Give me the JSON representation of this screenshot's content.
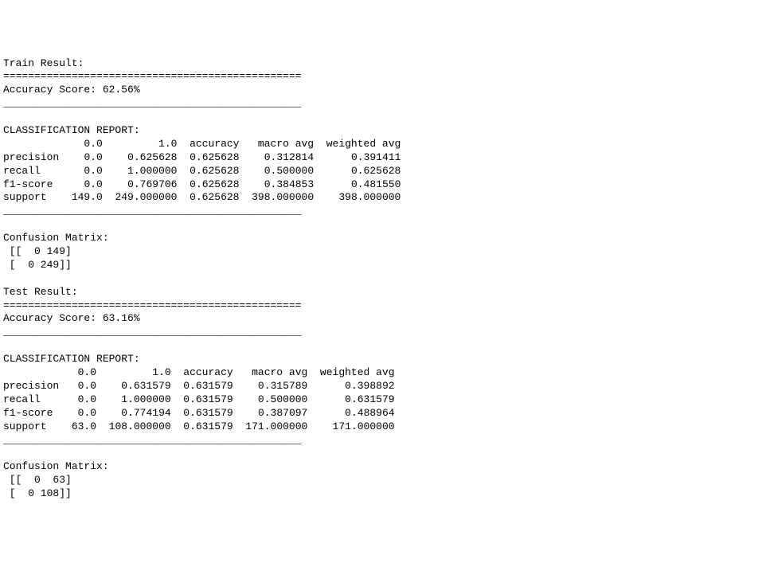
{
  "train": {
    "title": "Train Result:",
    "sep_dbl": "================================================",
    "accuracy_line": "Accuracy Score: 62.56%",
    "sep_single": "________________________________________________",
    "report": {
      "title": "CLASSIFICATION REPORT:",
      "columns": [
        "0.0",
        "1.0",
        "accuracy",
        "macro avg",
        "weighted avg"
      ],
      "rows": [
        {
          "label": "precision",
          "c0": "0.0",
          "c1": "0.625628",
          "acc": "0.625628",
          "macro": "0.312814",
          "weighted": "0.391411"
        },
        {
          "label": "recall",
          "c0": "0.0",
          "c1": "1.000000",
          "acc": "0.625628",
          "macro": "0.500000",
          "weighted": "0.625628"
        },
        {
          "label": "f1-score",
          "c0": "0.0",
          "c1": "0.769706",
          "acc": "0.625628",
          "macro": "0.384853",
          "weighted": "0.481550"
        },
        {
          "label": "support",
          "c0": "149.0",
          "c1": "249.000000",
          "acc": "0.625628",
          "macro": "398.000000",
          "weighted": "398.000000"
        }
      ]
    },
    "cm": {
      "title": "Confusion Matrix: ",
      "row0": " [[  0 149]",
      "row1": " [  0 249]]"
    }
  },
  "test": {
    "title": "Test Result:",
    "sep_dbl": "================================================",
    "accuracy_line": "Accuracy Score: 63.16%",
    "sep_single": "________________________________________________",
    "report": {
      "title": "CLASSIFICATION REPORT:",
      "columns": [
        "0.0",
        "1.0",
        "accuracy",
        "macro avg",
        "weighted avg"
      ],
      "rows": [
        {
          "label": "precision",
          "c0": "0.0",
          "c1": "0.631579",
          "acc": "0.631579",
          "macro": "0.315789",
          "weighted": "0.398892"
        },
        {
          "label": "recall",
          "c0": "0.0",
          "c1": "1.000000",
          "acc": "0.631579",
          "macro": "0.500000",
          "weighted": "0.631579"
        },
        {
          "label": "f1-score",
          "c0": "0.0",
          "c1": "0.774194",
          "acc": "0.631579",
          "macro": "0.387097",
          "weighted": "0.488964"
        },
        {
          "label": "support",
          "c0": "63.0",
          "c1": "108.000000",
          "acc": "0.631579",
          "macro": "171.000000",
          "weighted": "171.000000"
        }
      ]
    },
    "cm": {
      "title": "Confusion Matrix: ",
      "row0": " [[  0  63]",
      "row1": " [  0 108]]"
    }
  }
}
